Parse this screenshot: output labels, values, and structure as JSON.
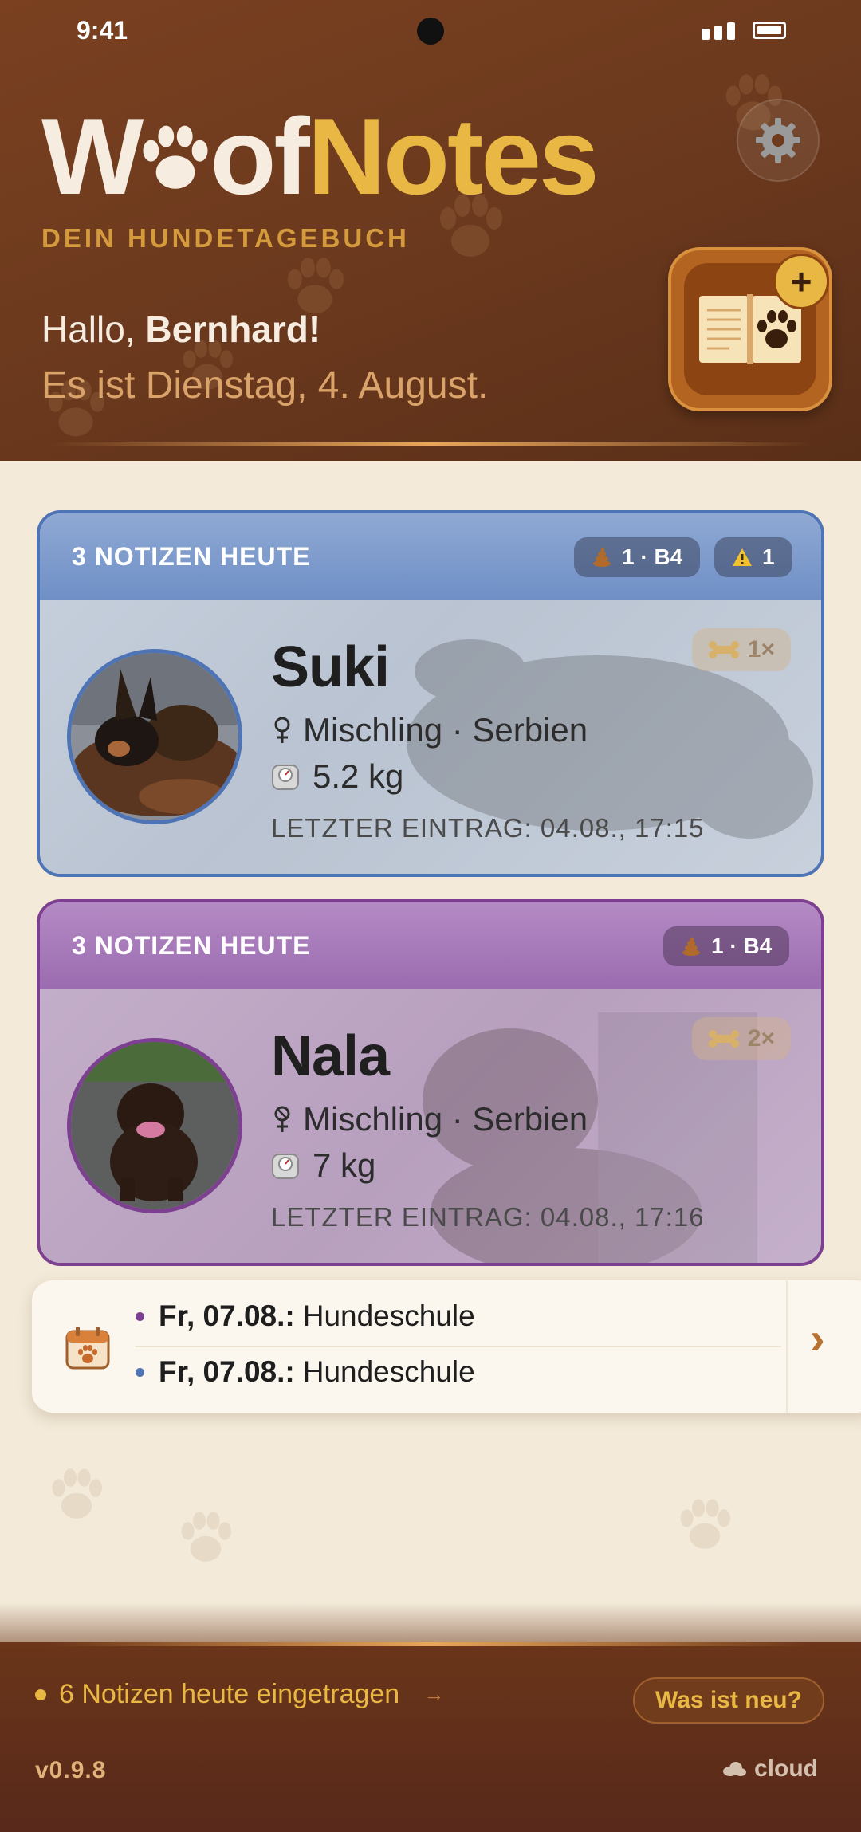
{
  "status_bar": {
    "time": "9:41"
  },
  "header": {
    "logo_w": "W",
    "logo_of": "of",
    "logo_notes": "Notes",
    "subtitle": "DEIN HUNDETAGEBUCH",
    "greeting_prefix": "Hallo, ",
    "greeting_name": "Bernhard!",
    "date_line": "Es ist Dienstag, 4. August."
  },
  "dogs": [
    {
      "header_label": "3 NOTIZEN HEUTE",
      "chips": [
        {
          "icon": "poop-icon",
          "text": "1 · B4"
        },
        {
          "icon": "warning-icon",
          "text": "1"
        }
      ],
      "name": "Suki",
      "sex_icon": "female-icon",
      "breed": "Mischling · Serbien",
      "weight": "5.2 kg",
      "last_entry": "LETZTER EINTRAG: 04.08., 17:15",
      "treats": "1×",
      "accent": "#4e74b5"
    },
    {
      "header_label": "3 NOTIZEN HEUTE",
      "chips": [
        {
          "icon": "poop-icon",
          "text": "1 · B4"
        }
      ],
      "name": "Nala",
      "sex_icon": "female-spayed-icon",
      "breed": "Mischling · Serbien",
      "weight": "7 kg",
      "last_entry": "LETZTER EINTRAG: 04.08., 17:16",
      "treats": "2×",
      "accent": "#7d3f8f"
    }
  ],
  "calendar": {
    "events": [
      {
        "date": "Fr, 07.08.:",
        "title": "Hundeschule",
        "dot_color": "#7d3f8f"
      },
      {
        "date": "Fr, 07.08.:",
        "title": "Hundeschule",
        "dot_color": "#4e74b5"
      }
    ],
    "more": "›"
  },
  "footer": {
    "notes_today": "6 Notizen heute eingetragen",
    "notes_arrow": "→",
    "whats_new": "Was ist neu?",
    "version": "v0.9.8",
    "sync": "cloud"
  },
  "colors": {
    "brand_brown": "#6d3a1e",
    "brand_gold": "#e8b744",
    "suki_accent": "#4e74b5",
    "nala_accent": "#7d3f8f"
  }
}
